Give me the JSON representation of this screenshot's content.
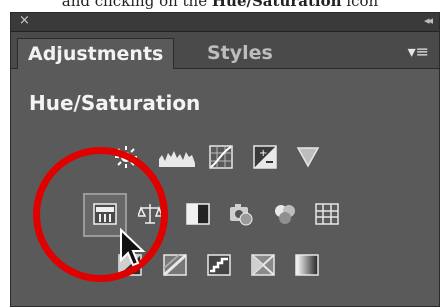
{
  "caption": {
    "prefix": "and clicking on the ",
    "bold": "Hue/Saturation",
    "suffix": " icon"
  },
  "panel": {
    "close_glyph": "×",
    "collapse_glyph": "◂◂",
    "menu_glyph": "▾≡",
    "tabs": [
      {
        "label": "Adjustments",
        "active": true
      },
      {
        "label": "Styles",
        "active": false
      }
    ],
    "section_title": "Hue/Saturation"
  },
  "icons": [
    {
      "name": "brightness-contrast-icon"
    },
    {
      "name": "levels-icon"
    },
    {
      "name": "curves-icon"
    },
    {
      "name": "exposure-icon"
    },
    {
      "name": "vibrance-icon"
    },
    {
      "name": "hue-saturation-icon",
      "selected": true
    },
    {
      "name": "color-balance-icon"
    },
    {
      "name": "black-white-icon"
    },
    {
      "name": "photo-filter-icon"
    },
    {
      "name": "channel-mixer-icon"
    },
    {
      "name": "color-lookup-icon"
    },
    {
      "name": "invert-icon"
    },
    {
      "name": "posterize-icon"
    },
    {
      "name": "threshold-icon"
    },
    {
      "name": "selective-color-icon"
    },
    {
      "name": "gradient-map-icon"
    }
  ],
  "colors": {
    "panel_bg": "#5a5a5a",
    "highlight_ring": "#e00000"
  }
}
